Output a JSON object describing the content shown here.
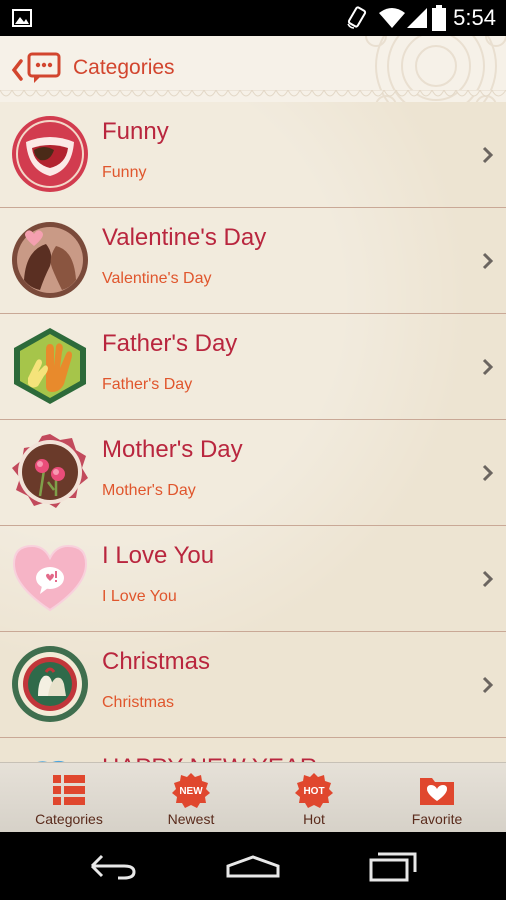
{
  "status_bar": {
    "time": "5:54"
  },
  "header": {
    "title": "Categories"
  },
  "categories": [
    {
      "title": "Funny",
      "subtitle": "Funny",
      "icon": "funny-mouth-icon"
    },
    {
      "title": "Valentine's Day",
      "subtitle": "Valentine's Day",
      "icon": "valentine-kiss-icon"
    },
    {
      "title": "Father's Day",
      "subtitle": "Father's Day",
      "icon": "fathers-day-hands-icon"
    },
    {
      "title": "Mother's Day",
      "subtitle": "Mother's Day",
      "icon": "mothers-day-flowers-icon"
    },
    {
      "title": "I Love You",
      "subtitle": "I Love You",
      "icon": "love-heart-icon"
    },
    {
      "title": "Christmas",
      "subtitle": "Christmas",
      "icon": "christmas-bells-icon"
    },
    {
      "title": "HAPPY NEW YEAR",
      "subtitle": "",
      "icon": "new-year-icon"
    }
  ],
  "tabs": [
    {
      "label": "Categories",
      "icon": "categories-list-icon"
    },
    {
      "label": "Newest",
      "icon": "new-badge-icon",
      "badge": "NEW"
    },
    {
      "label": "Hot",
      "icon": "hot-badge-icon",
      "badge": "HOT"
    },
    {
      "label": "Favorite",
      "icon": "favorite-folder-icon"
    }
  ],
  "colors": {
    "accent": "#d2452e",
    "title": "#b9263e",
    "subtitle": "#e0562d",
    "background": "#ede4d2"
  }
}
